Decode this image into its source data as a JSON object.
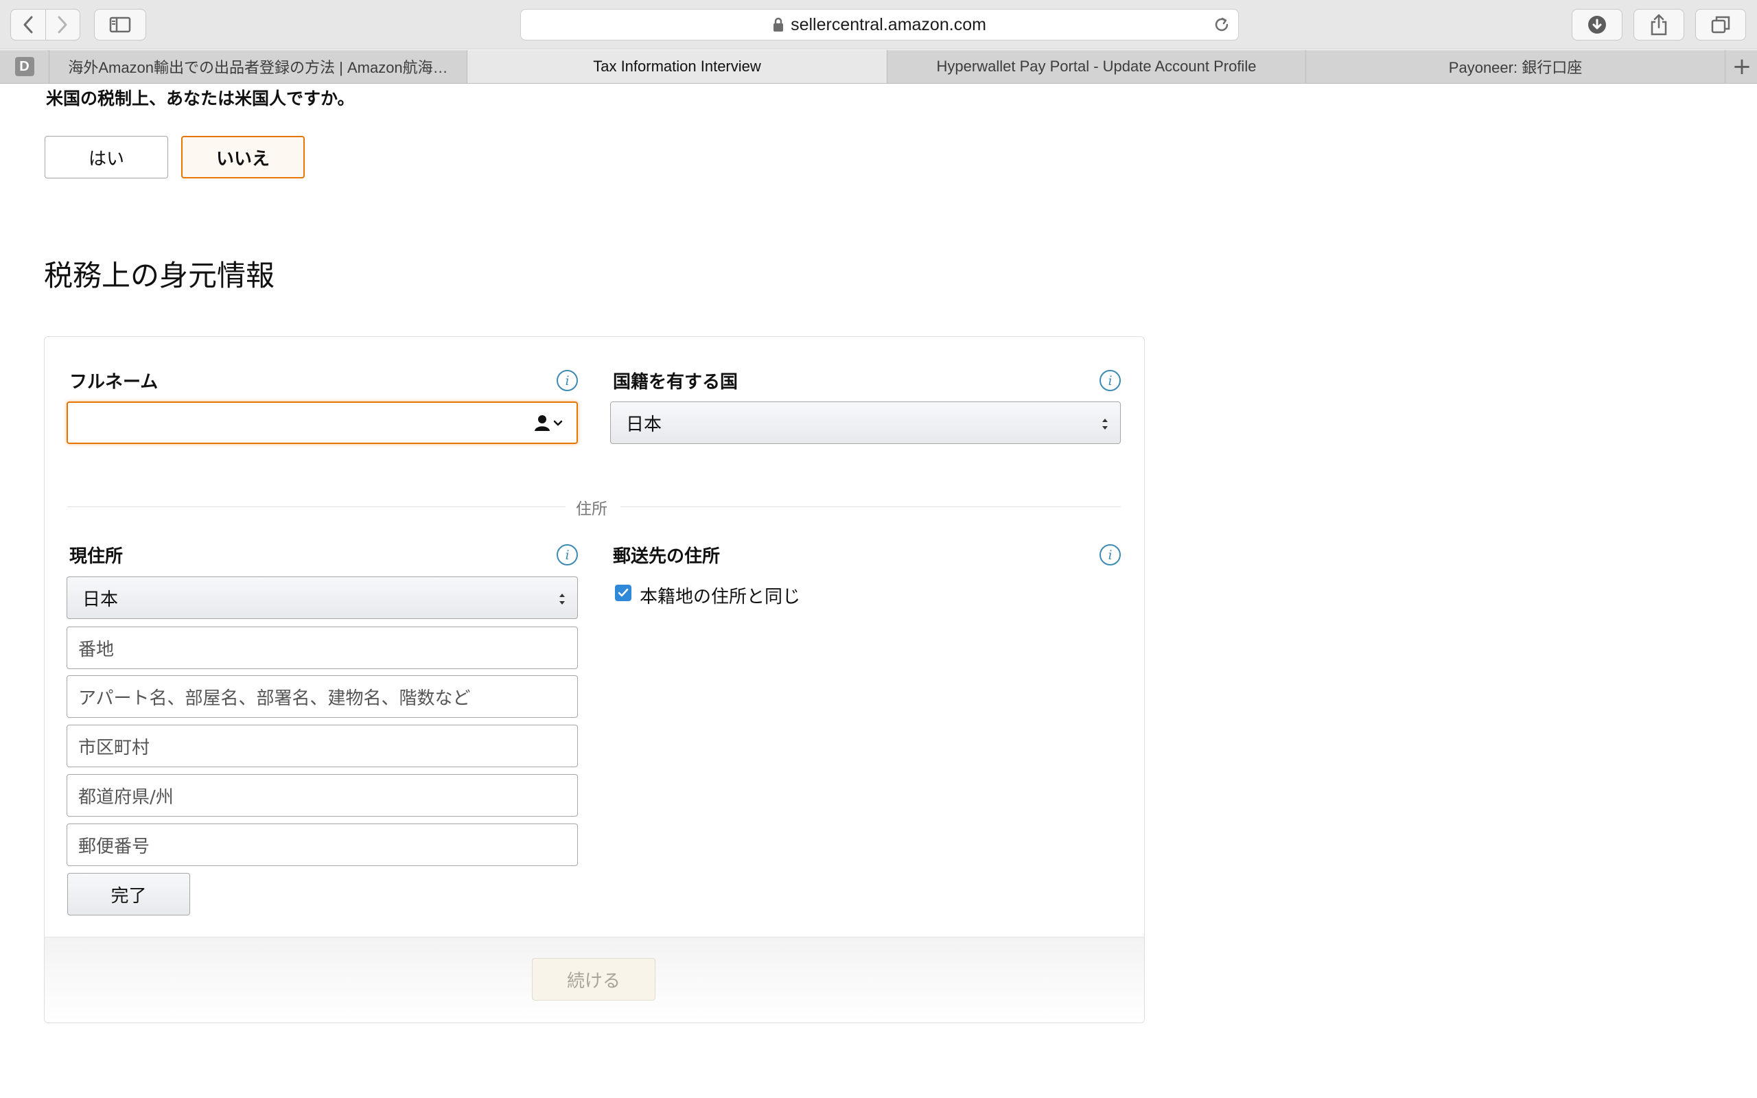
{
  "browser": {
    "url": "sellercentral.amazon.com",
    "tabs": [
      {
        "title": "海外Amazon輸出での出品者登録の方法 | Amazon航海…",
        "active": false
      },
      {
        "title": "Tax Information Interview",
        "active": true
      },
      {
        "title": "Hyperwallet Pay Portal - Update Account Profile",
        "active": false
      },
      {
        "title": "Payoneer: 銀行口座",
        "active": false
      }
    ],
    "pinned_tab_letter": "D",
    "new_tab_symbol": "+"
  },
  "question": {
    "text": "米国の税制上、あなたは米国人ですか。",
    "yes_label": "はい",
    "no_label": "いいえ",
    "selected": "いいえ"
  },
  "section_title": "税務上の身元情報",
  "form": {
    "full_name": {
      "label": "フルネーム",
      "value": "",
      "placeholder": ""
    },
    "citizenship": {
      "label": "国籍を有する国",
      "value": "日本"
    },
    "address_divider": "住所",
    "current_address": {
      "label": "現住所",
      "country": "日本",
      "street_placeholder": "番地",
      "apartment_placeholder": "アパート名、部屋名、部署名、建物名、階数など",
      "city_placeholder": "市区町村",
      "state_placeholder": "都道府県/州",
      "postal_placeholder": "郵便番号",
      "done_label": "完了"
    },
    "mailing_address": {
      "label": "郵送先の住所",
      "same_as_checked": true,
      "same_as_label": "本籍地の住所と同じ"
    },
    "continue_label": "続ける"
  },
  "colors": {
    "accent_orange": "#e77600",
    "info_blue": "#3d8bb3",
    "checkbox_blue": "#2f88d8"
  }
}
